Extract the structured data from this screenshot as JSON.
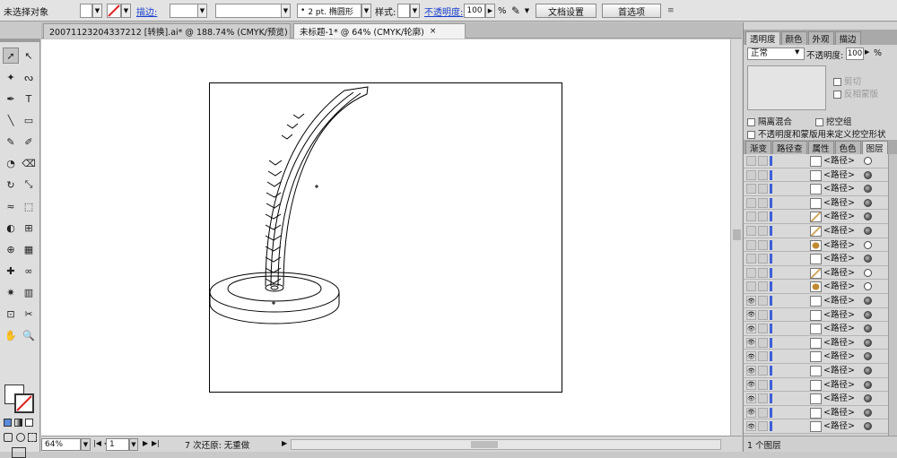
{
  "control_bar": {
    "selection_status": "未选择对象",
    "stroke_label": "描边:",
    "brush_size_label": "2 pt. 椭圆形",
    "style_label": "样式:",
    "opacity_label": "不透明度:",
    "opacity_value": "100",
    "percent_sign": "%",
    "doc_setup_button": "文档设置",
    "preferences_button": "首选项"
  },
  "tabs": [
    {
      "label": "20071123204337212 [转换].ai* @ 188.74% (CMYK/预览)",
      "close": "×"
    },
    {
      "label": "未标题-1* @ 64% (CMYK/轮廓)",
      "close": "×"
    }
  ],
  "status_bar": {
    "zoom": "64%",
    "page": "1",
    "undo_info": "7 次还原: 无重做"
  },
  "transparency_panel": {
    "tabs": [
      "透明度",
      "颜色",
      "外观",
      "描边"
    ],
    "blend_mode": "正常",
    "opacity_label": "不透明度:",
    "opacity_value": "100",
    "percent_sign": "%",
    "clip_label": "剪切",
    "invert_mask_label": "反相蒙版",
    "isolate_blend_label": "隔离混合",
    "knockout_group_label": "挖空组",
    "opacity_mask_label": "不透明度和蒙版用来定义挖空形状"
  },
  "layers_panel": {
    "tabs": [
      "渐变",
      "路径查",
      "属性",
      "色色",
      "图层"
    ],
    "footer_label": "1 个图层",
    "rows": [
      {
        "name": "<路径>",
        "eye": false,
        "thumb": "plain",
        "target": "empty"
      },
      {
        "name": "<路径>",
        "eye": false,
        "thumb": "plain",
        "target": "filled"
      },
      {
        "name": "<路径>",
        "eye": false,
        "thumb": "plain",
        "target": "filled"
      },
      {
        "name": "<路径>",
        "eye": false,
        "thumb": "plain",
        "target": "filled"
      },
      {
        "name": "<路径>",
        "eye": false,
        "thumb": "gold-stripe",
        "target": "filled"
      },
      {
        "name": "<路径>",
        "eye": false,
        "thumb": "gold-stripe",
        "target": "filled"
      },
      {
        "name": "<路径>",
        "eye": false,
        "thumb": "gold-leaf",
        "target": "empty"
      },
      {
        "name": "<路径>",
        "eye": false,
        "thumb": "plain",
        "target": "filled"
      },
      {
        "name": "<路径>",
        "eye": false,
        "thumb": "gold-stripe",
        "target": "empty"
      },
      {
        "name": "<路径>",
        "eye": false,
        "thumb": "gold-leaf",
        "target": "empty"
      },
      {
        "name": "<路径>",
        "eye": true,
        "thumb": "plain",
        "target": "filled"
      },
      {
        "name": "<路径>",
        "eye": true,
        "thumb": "plain",
        "target": "filled"
      },
      {
        "name": "<路径>",
        "eye": true,
        "thumb": "plain",
        "target": "filled"
      },
      {
        "name": "<路径>",
        "eye": true,
        "thumb": "plain",
        "target": "filled"
      },
      {
        "name": "<路径>",
        "eye": true,
        "thumb": "plain",
        "target": "filled"
      },
      {
        "name": "<路径>",
        "eye": true,
        "thumb": "plain",
        "target": "filled"
      },
      {
        "name": "<路径>",
        "eye": true,
        "thumb": "plain",
        "target": "filled"
      },
      {
        "name": "<路径>",
        "eye": true,
        "thumb": "plain",
        "target": "filled"
      },
      {
        "name": "<路径>",
        "eye": true,
        "thumb": "plain",
        "target": "filled"
      },
      {
        "name": "<路径>",
        "eye": true,
        "thumb": "plain",
        "target": "filled"
      }
    ]
  },
  "tools": [
    "selection-tool-icon",
    "direct-selection-tool-icon",
    "magic-wand-tool-icon",
    "lasso-tool-icon",
    "pen-tool-icon",
    "type-tool-icon",
    "line-tool-icon",
    "rectangle-tool-icon",
    "paintbrush-tool-icon",
    "pencil-tool-icon",
    "blob-brush-tool-icon",
    "eraser-tool-icon",
    "rotate-tool-icon",
    "scale-tool-icon",
    "width-tool-icon",
    "free-transform-tool-icon",
    "shape-builder-tool-icon",
    "perspective-grid-tool-icon",
    "mesh-tool-icon",
    "gradient-tool-icon",
    "eyedropper-tool-icon",
    "blend-tool-icon",
    "symbol-sprayer-tool-icon",
    "column-graph-tool-icon",
    "artboard-tool-icon",
    "slice-tool-icon",
    "hand-tool-icon",
    "zoom-tool-icon"
  ],
  "colors": {
    "ui_background": "#d4d4d4",
    "path_target_blue": "#3d5fd6",
    "thumbnail_gold": "#c08a2e",
    "link_blue": "#1a3fd0"
  }
}
